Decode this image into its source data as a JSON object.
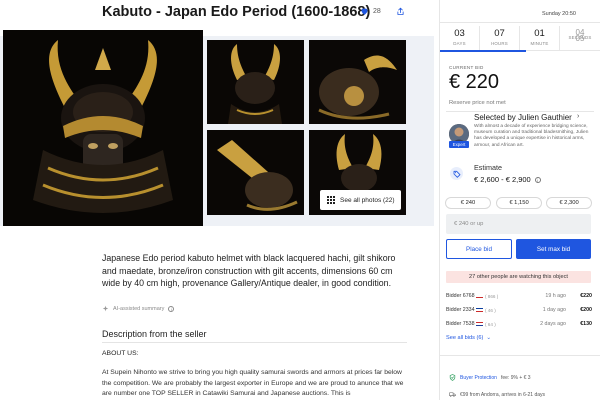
{
  "listing": {
    "title": "Kabuto - Japan Edo Period (1600-1868)",
    "favorites_count": "28",
    "see_all_photos": "See all photos (22)",
    "description": "Japanese Edo period kabuto helmet with black lacquered hachi, gilt shikoro and maedate, bronze/iron construction with gilt accents, dimensions 60 cm wide by 40 cm high, provenance Gallery/Antique dealer, in good condition.",
    "ai_note": "AI-assisted summary",
    "seller_heading": "Description from the seller",
    "about_heading": "ABOUT US:",
    "about_text": "At Supein Nihonto we strive to bring you high quality samurai swords and armors at prices far below the competition. We are probably the largest exporter in Europe and we are proud to anunce that we are number one TOP SELLER in Catawiki Samurai and Japanese auctions. This is"
  },
  "auction": {
    "closing": "Sunday 20:50",
    "countdown": [
      {
        "value": "03",
        "label": "DAYS"
      },
      {
        "value": "07",
        "label": "HOURS"
      },
      {
        "value": "01",
        "label": "MINUTE"
      },
      {
        "value": "04",
        "value2": "05",
        "label": "SECONDS"
      }
    ],
    "countdown_progress": 0.54,
    "current_bid_label": "CURRENT BID",
    "current_bid": "€ 220",
    "reserve_note": "Reserve price not met",
    "expert_heading": "Selected by Julien Gauthier",
    "expert_badge": "Expert",
    "expert_bio": "With almost a decade of experience bridging science, museum curation and traditional bladesmithing, Julien has developed a unique expertise in historical arms, armour, and African art.",
    "estimate_label": "Estimate",
    "estimate_value": "€ 2,600 - € 2,900",
    "quick_bids": [
      "€ 240",
      "€ 1,150",
      "€ 2,300"
    ],
    "bid_placeholder": "€ 240 or up",
    "place_bid": "Place bid",
    "set_max_bid": "Set max bid",
    "watching": "27 other people are watching this object",
    "bids": [
      {
        "bidder": "Bidder 6768",
        "count": "( 866 )",
        "time": "19 h ago",
        "amount": "€220",
        "flag": [
          "#ffffff",
          "#ffffff",
          "#cc2a2a"
        ]
      },
      {
        "bidder": "Bidder 2334",
        "count": "( 46 )",
        "time": "1 day ago",
        "amount": "€200",
        "flag": [
          "#0a3ea0",
          "#ffffff",
          "#cc2a2a"
        ]
      },
      {
        "bidder": "Bidder 7538",
        "count": "( 64 )",
        "time": "2 days ago",
        "amount": "€130",
        "flag": [
          "#cc2a2a",
          "#ffffff",
          "#1f3f98"
        ]
      }
    ],
    "see_all_bids": "See all bids (6)",
    "buyer_protection_link": "Buyer Protection",
    "buyer_protection_text": "fee: 9% + € 3",
    "shipping": "€99 from Andorra, arrives in 6-21 days"
  },
  "colors": {
    "accent": "#1f56e0",
    "watching_bg": "#fbe3e1",
    "gallery_band": "#eef1f6"
  }
}
